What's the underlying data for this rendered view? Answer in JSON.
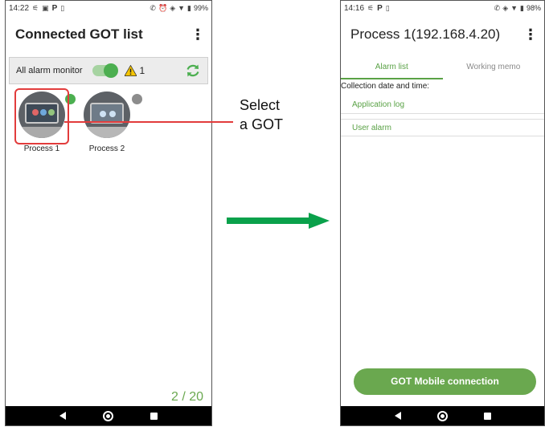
{
  "left_screen": {
    "status": {
      "time": "14:22",
      "battery": "99%"
    },
    "title": "Connected GOT list",
    "menu_glyph": "⋮",
    "alarm_monitor": {
      "label": "All alarm monitor",
      "enabled": true,
      "warning_count": "1"
    },
    "gots": [
      {
        "name": "Process 1",
        "status_color": "#4caf50"
      },
      {
        "name": "Process 2",
        "status_color": "#8c8c8c"
      }
    ],
    "pager": "2 / 20"
  },
  "callout": {
    "line1": "Select",
    "line2": "a GOT"
  },
  "right_screen": {
    "status": {
      "time": "14:16",
      "battery": "98%"
    },
    "title": "Process 1(192.168.4.20)",
    "menu_glyph": "⋮",
    "tabs": [
      {
        "label": "Alarm list",
        "active": true
      },
      {
        "label": "Working memo",
        "active": false
      }
    ],
    "collection_label": "Collection date and time:",
    "list": [
      "Application log",
      "User alarm"
    ],
    "connect_button": "GOT Mobile connection"
  },
  "colors": {
    "accent": "#6aa84f",
    "highlight": "#e23c3c",
    "arrow": "#0aa14b"
  }
}
